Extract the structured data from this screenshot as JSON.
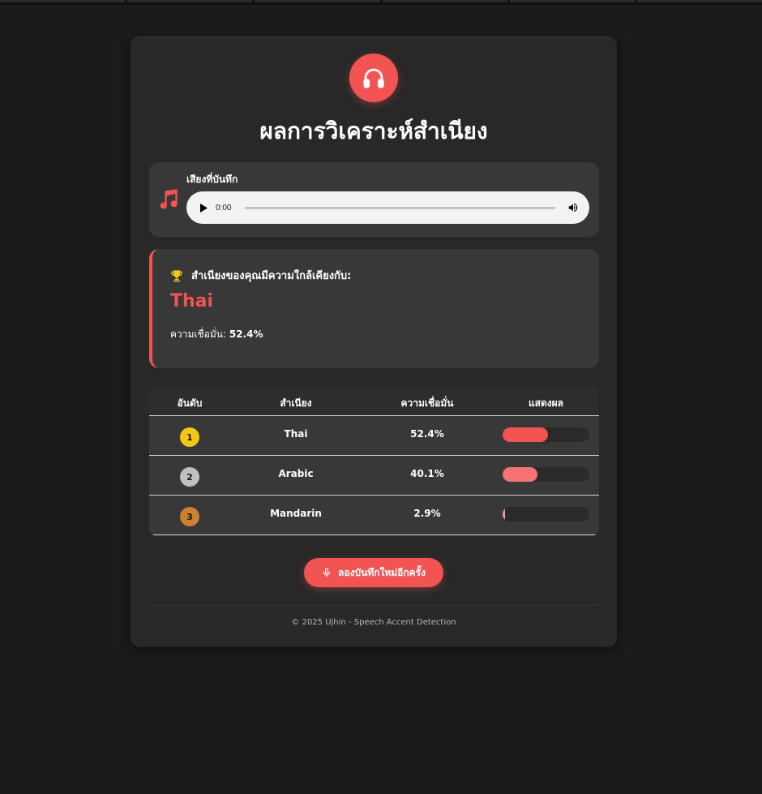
{
  "page": {
    "title": "ผลการวิเคราะห์สำเนียง",
    "logo_icon": "headphones-icon"
  },
  "audio": {
    "icon": "music-note-icon",
    "label": "เสียงที่บันทึก",
    "time": "0:00",
    "progress": 0
  },
  "result": {
    "icon": "trophy-icon",
    "heading": "สำเนียงของคุณมีความใกล้เคียงกับ:",
    "language": "Thai",
    "confidence_label": "ความเชื่อมั่น:",
    "confidence_value": "52.4%"
  },
  "table": {
    "headers": [
      "อันดับ",
      "สำเนียง",
      "ความเชื่อมั่น",
      "แสดงผล"
    ],
    "rows": [
      {
        "rank": "1",
        "accent": "Thai",
        "confidence": "52.4%",
        "value": 52.4,
        "badge_color": "#f5c518",
        "bar_color": "#f25353"
      },
      {
        "rank": "2",
        "accent": "Arabic",
        "confidence": "40.1%",
        "value": 40.1,
        "badge_color": "#c0c0c0",
        "bar_color": "#f77272"
      },
      {
        "rank": "3",
        "accent": "Mandarin",
        "confidence": "2.9%",
        "value": 2.9,
        "badge_color": "#cd7f32",
        "bar_color": "#f79a9a"
      }
    ]
  },
  "actions": {
    "retry_label": "ลองบันทึกใหม่อีกครั้ง",
    "retry_icon": "microphone-icon"
  },
  "footer": {
    "text": "© 2025 Ujhin - Speech Accent Detection"
  },
  "colors": {
    "accent": "#f25353",
    "background": "#1b1b1b",
    "card": "#282828",
    "panel": "#383838"
  }
}
